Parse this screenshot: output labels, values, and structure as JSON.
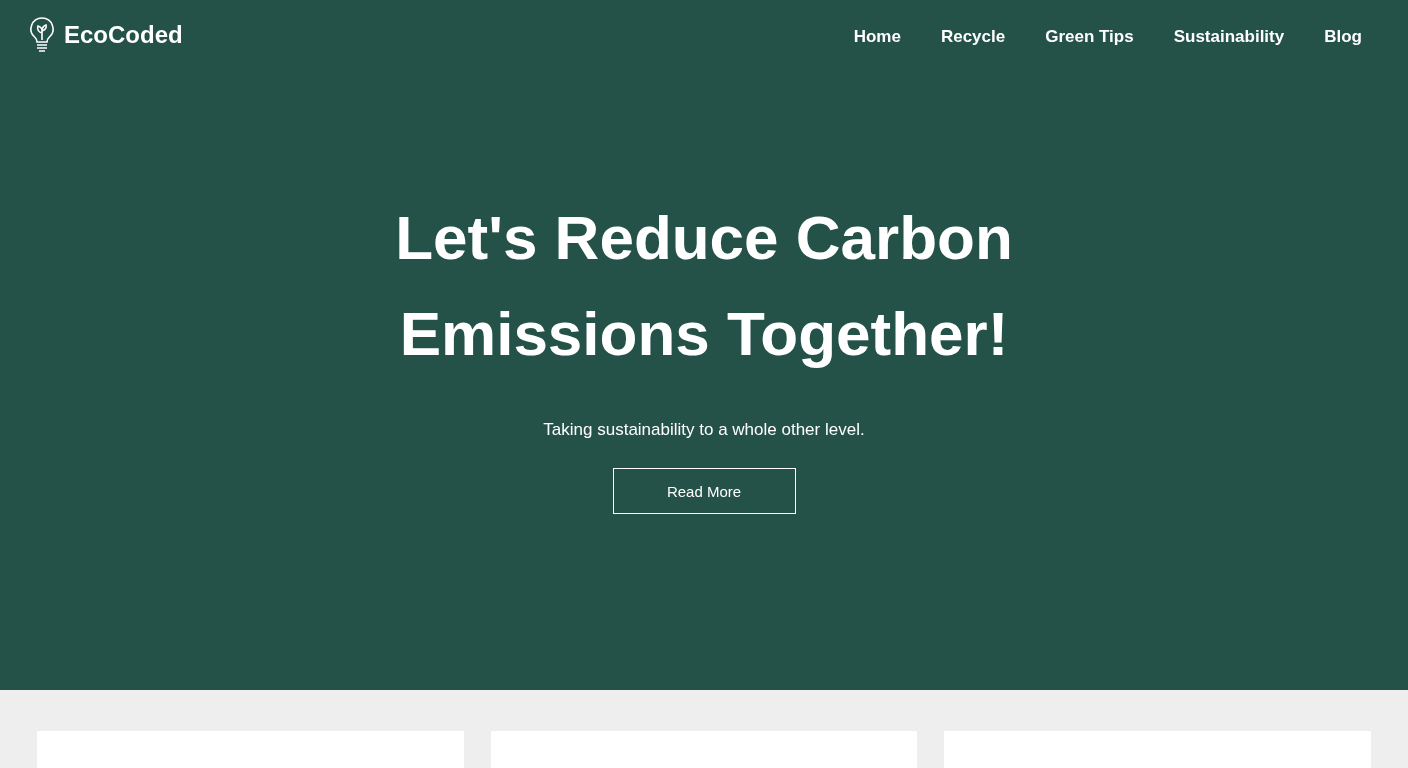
{
  "brand": {
    "name": "EcoCoded"
  },
  "nav": [
    {
      "label": "Home"
    },
    {
      "label": "Recycle"
    },
    {
      "label": "Green Tips"
    },
    {
      "label": "Sustainability"
    },
    {
      "label": "Blog"
    }
  ],
  "hero": {
    "title_lines": [
      "Let's Reduce Carbon",
      "Emissions Together!"
    ],
    "subtitle": "Taking sustainability to a whole other level.",
    "button": "Read More"
  },
  "cards": [
    {
      "kind": "card"
    },
    {
      "kind": "card"
    },
    {
      "kind": "card"
    }
  ]
}
